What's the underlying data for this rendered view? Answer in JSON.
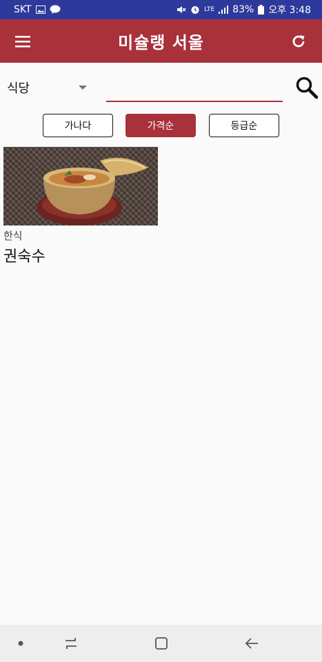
{
  "status_bar": {
    "carrier": "SKT",
    "battery": "83%",
    "time": "오후 3:48",
    "network": "LTE"
  },
  "app_bar": {
    "title": "미슐랭 서울"
  },
  "search": {
    "category": "식당",
    "value": "",
    "placeholder": ""
  },
  "sort": {
    "buttons": [
      "가나다",
      "가격순",
      "등급순"
    ],
    "active": "가격순"
  },
  "results": [
    {
      "category": "한식",
      "name": "권숙수"
    }
  ],
  "colors": {
    "status_bar": "#2d3a9b",
    "primary": "#a8313a",
    "background": "#fafafa",
    "nav_bar": "#eeeeee"
  }
}
